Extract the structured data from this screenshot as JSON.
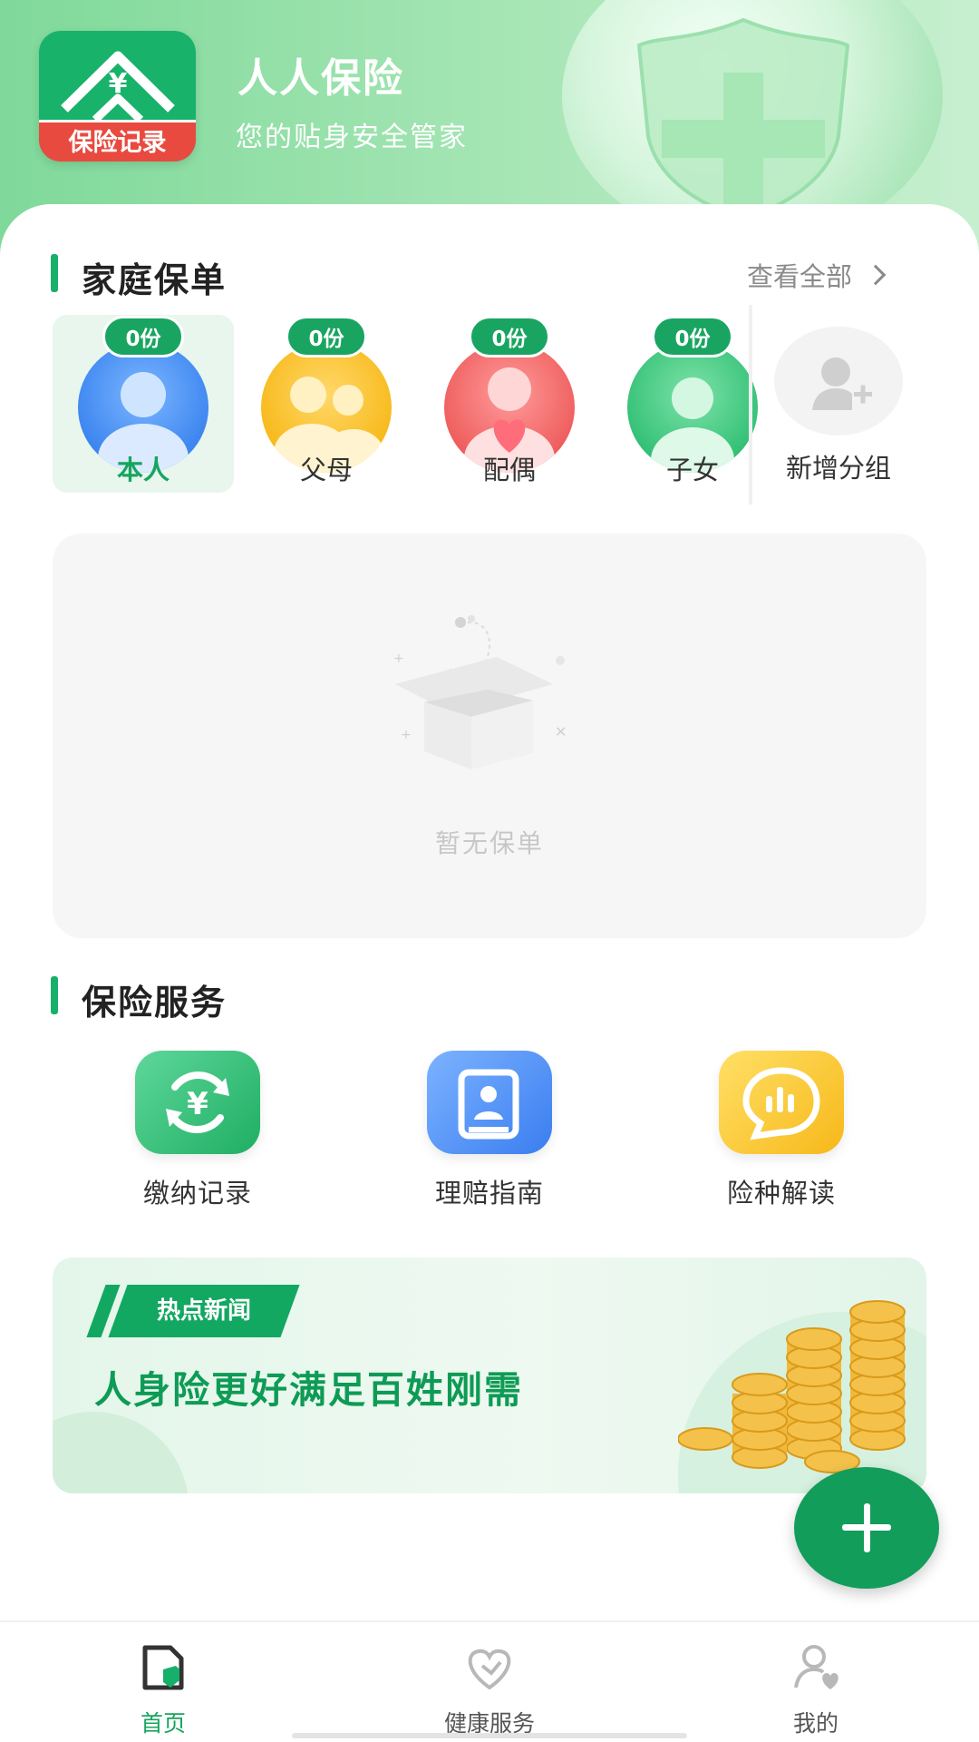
{
  "app": {
    "logo_text": "保险记录",
    "title": "人人保险",
    "subtitle": "您的贴身安全管家"
  },
  "family": {
    "title": "家庭保单",
    "view_all": "查看全部",
    "groups": [
      {
        "label": "本人",
        "count": "0份",
        "selected": true
      },
      {
        "label": "父母",
        "count": "0份",
        "selected": false
      },
      {
        "label": "配偶",
        "count": "0份",
        "selected": false
      },
      {
        "label": "子女",
        "count": "0份",
        "selected": false
      }
    ],
    "add_group": "新增分组",
    "empty_text": "暂无保单"
  },
  "services": {
    "title": "保险服务",
    "items": [
      {
        "label": "缴纳记录",
        "icon": "payment-record-icon"
      },
      {
        "label": "理赔指南",
        "icon": "claim-guide-icon"
      },
      {
        "label": "险种解读",
        "icon": "insurance-explain-icon"
      }
    ]
  },
  "banner": {
    "tag": "热点新闻",
    "headline": "人身险更好满足百姓刚需"
  },
  "nav": {
    "items": [
      {
        "label": "首页",
        "active": true
      },
      {
        "label": "健康服务",
        "active": false
      },
      {
        "label": "我的",
        "active": false
      }
    ]
  },
  "colors": {
    "brand_green": "#17b06b",
    "header_green": "#7fd99a",
    "fab_green": "#129d5b"
  }
}
